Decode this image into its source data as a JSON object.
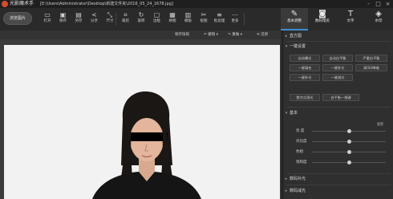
{
  "window": {
    "app_title": "光影魔术手",
    "file_path": "[E:\\Users\\Administrator\\Desktop\\新建文件夹\\2016_05_24_1678.jpg]",
    "controls": [
      "-",
      "□",
      "×"
    ]
  },
  "toolbar": {
    "open_label": "浏览图片",
    "tools": [
      {
        "label": "打开",
        "icon": "folder-icon",
        "glyph": "▭"
      },
      {
        "label": "保存",
        "icon": "save-icon",
        "glyph": "▣"
      },
      {
        "label": "另存",
        "icon": "save-as-icon",
        "glyph": "▤"
      },
      {
        "label": "分享",
        "icon": "share-icon",
        "glyph": "<"
      },
      {
        "label": "尺寸",
        "icon": "resize-icon",
        "glyph": "⤡"
      },
      {
        "label": "裁剪",
        "icon": "crop-icon",
        "glyph": "⌗"
      },
      {
        "label": "旋转",
        "icon": "rotate-icon",
        "glyph": "↻"
      },
      {
        "label": "边框",
        "icon": "frame-icon",
        "glyph": "▢"
      },
      {
        "label": "拼图",
        "icon": "collage-icon",
        "glyph": "▦"
      },
      {
        "label": "模板",
        "icon": "template-icon",
        "glyph": "▥"
      },
      {
        "label": "抠图",
        "icon": "cutout-icon",
        "glyph": "✂"
      },
      {
        "label": "批处理",
        "icon": "batch-icon",
        "glyph": "≡"
      },
      {
        "label": "更多",
        "icon": "more-icon",
        "glyph": "⋯"
      }
    ],
    "tabs": [
      {
        "label": "基本调整",
        "icon": "adjust-icon",
        "glyph": "✎",
        "active": true
      },
      {
        "label": "数码暗房",
        "icon": "camera-icon",
        "glyph": "◙",
        "active": false
      },
      {
        "label": "文字",
        "icon": "text-icon",
        "glyph": "T",
        "active": false
      },
      {
        "label": "水印",
        "icon": "watermark-icon",
        "glyph": "◈",
        "active": false
      }
    ]
  },
  "subbar": {
    "items": [
      "保存快照",
      "撤销",
      "重做",
      "还原"
    ]
  },
  "panel": {
    "histogram": "直方图",
    "one_click": "一键设置",
    "buttons_row1": [
      "自动曝光",
      "自动白平衡",
      "严重白平衡"
    ],
    "buttons_row2": [
      "一键填充",
      "一键补光",
      "高ISO降噪"
    ],
    "buttons_row3": [
      "一键补光",
      "一键减光"
    ],
    "buttons_row4": [
      "数字点测光",
      "白平衡一指键"
    ],
    "basic": "基本",
    "reset": "重置",
    "sliders": [
      {
        "label": "亮  度",
        "value": 0.5
      },
      {
        "label": "对比度",
        "value": 0.5
      },
      {
        "label": "色相",
        "value": 0.5
      },
      {
        "label": "饱和度",
        "value": 0.5
      }
    ],
    "digital_fill": "数码补光",
    "digital_reduce": "数码减光"
  },
  "colors": {
    "accent": "#3f8fd2",
    "photo_bg": "#f2f2f2",
    "censor_bar": "#000000"
  }
}
